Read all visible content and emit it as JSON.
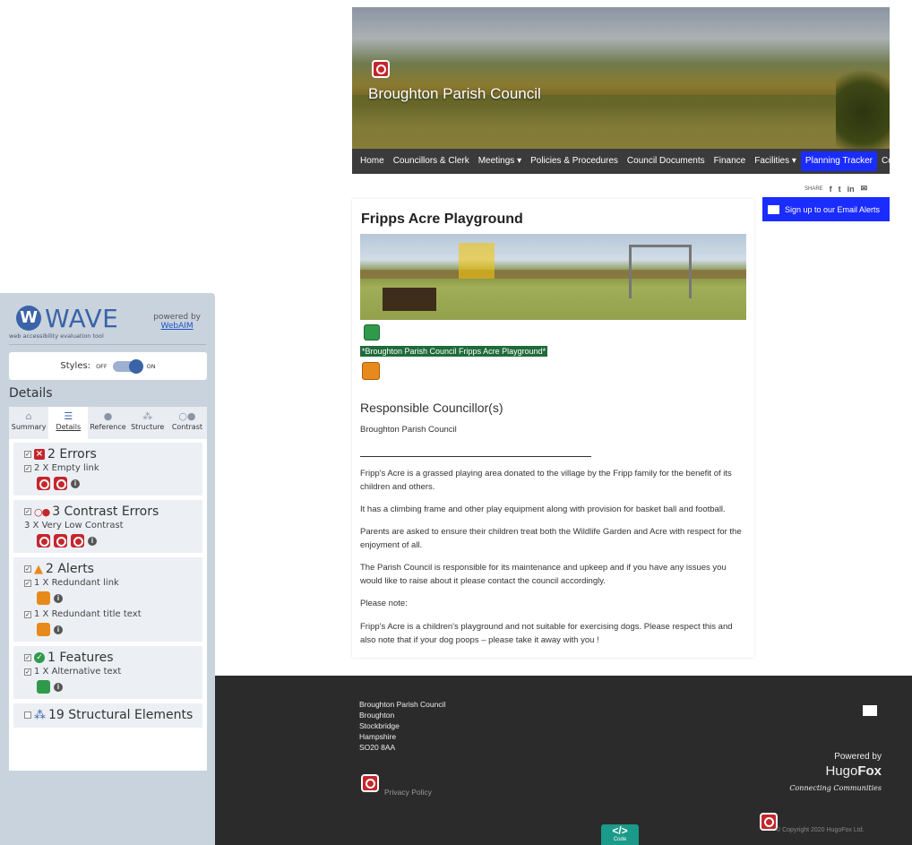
{
  "wave": {
    "name": "WAVE",
    "tagline": "web accessibility evaluation tool",
    "powered_by": "powered by",
    "webaim": "WebAIM",
    "styles_label": "Styles:",
    "styles_off": "OFF",
    "styles_on": "ON",
    "details_heading": "Details",
    "tabs": [
      {
        "label": "Summary",
        "icon": "home-icon"
      },
      {
        "label": "Details",
        "icon": "list-icon"
      },
      {
        "label": "Reference",
        "icon": "info-icon"
      },
      {
        "label": "Structure",
        "icon": "hierarchy-icon"
      },
      {
        "label": "Contrast",
        "icon": "contrast-icon"
      }
    ],
    "errors": {
      "title": "2 Errors",
      "item": "2 X Empty link"
    },
    "contrast": {
      "title": "3 Contrast Errors",
      "item": "3 X Very Low Contrast"
    },
    "alerts": {
      "title": "2 Alerts",
      "item1": "1 X Redundant link",
      "item2": "1 X Redundant title text"
    },
    "features": {
      "title": "1 Features",
      "item": "1 X Alternative text"
    },
    "structure": {
      "title": "19 Structural Elements"
    }
  },
  "site": {
    "title": "Broughton Parish Council",
    "nav": [
      "Home",
      "Councillors & Clerk",
      "Meetings ▾",
      "Policies & Procedures",
      "Council Documents",
      "Finance",
      "Facilities ▾",
      "Planning Tracker",
      "Contact"
    ],
    "share_label": "SHARE",
    "share_icons": [
      "f",
      "t",
      "in",
      "✉"
    ],
    "email_alerts": "Sign up to our Email Alerts",
    "page_title": "Fripps Acre Playground",
    "caption": "*Broughton Parish Council Fripps Acre Playground*",
    "responsible_heading": "Responsible Councillor(s)",
    "responsible_text": "Broughton Parish Council",
    "paragraphs": [
      "Fripp's Acre is a grassed playing area donated to the village by the Fripp family for the benefit of its children and others.",
      "It has a climbing frame and other play equipment along with provision for basket ball and football.",
      "Parents are asked to ensure their children treat both the Wildlife Garden and Acre with respect for the enjoyment of all.",
      "The Parish Council is responsible for its maintenance and upkeep and if you have any issues you would like to raise about it please contact the council accordingly.",
      "Please note:",
      "Fripp's Acre is a children's playground and not suitable for exercising dogs.  Please respect this and also note that if your dog poops – please take it away with you !"
    ]
  },
  "footer": {
    "address": [
      "Broughton Parish Council",
      "Broughton",
      "Stockbridge",
      "Hampshire",
      "SO20 8AA"
    ],
    "powered_by": "Powered by",
    "hugo": "Hugo",
    "fox": "Fox",
    "tagline": "Connecting Communities",
    "privacy": "Privacy Policy",
    "copyright": "© Copyright 2020 HugoFox Ltd.",
    "code_label": "Code",
    "code_icon": "</>"
  }
}
